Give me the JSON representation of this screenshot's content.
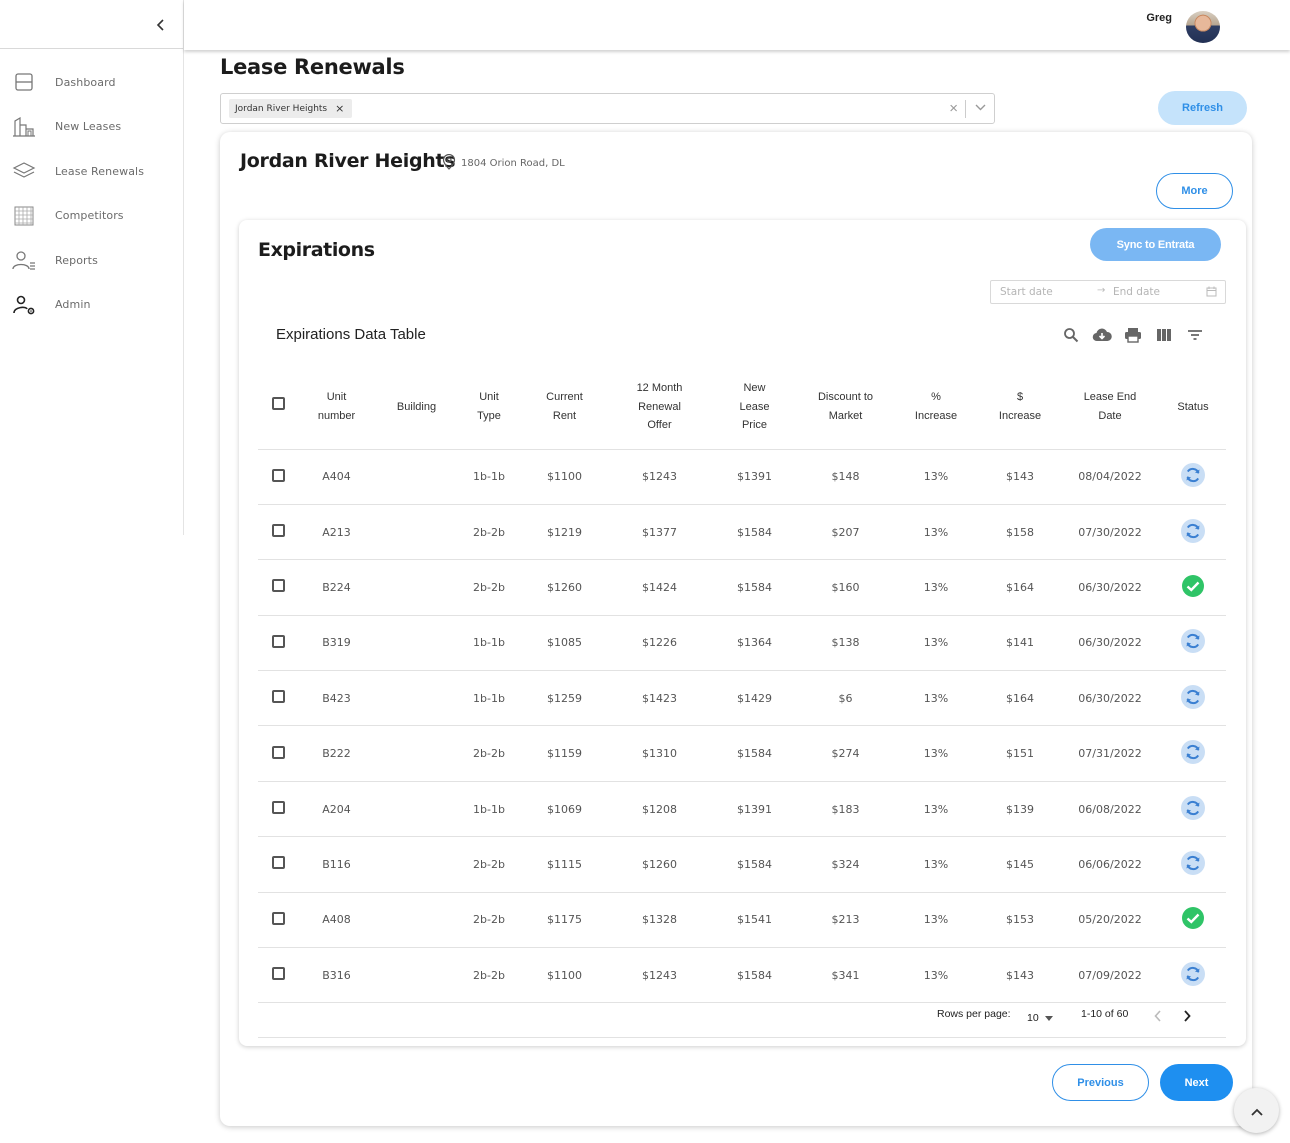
{
  "sidebar": {
    "collapse_icon": "chevron-left-icon",
    "items": [
      {
        "label": "Dashboard",
        "icon": "dashboard-icon"
      },
      {
        "label": "New Leases",
        "icon": "building-icon"
      },
      {
        "label": "Lease Renewals",
        "icon": "layers-icon"
      },
      {
        "label": "Competitors",
        "icon": "grid-icon"
      },
      {
        "label": "Reports",
        "icon": "user-list-icon"
      },
      {
        "label": "Admin",
        "icon": "user-gear-icon"
      }
    ]
  },
  "topbar": {
    "user_name": "Greg"
  },
  "page": {
    "title": "Lease Renewals"
  },
  "filter": {
    "chip_label": "Jordan River Heights",
    "chip_remove": "×",
    "clear": "×"
  },
  "refresh_label": "Refresh",
  "property": {
    "name": "Jordan River Heights",
    "address": "1804 Orion Road, DL",
    "more_label": "More"
  },
  "expirations": {
    "title": "Expirations",
    "sync_label": "Sync to Entrata",
    "date_range": {
      "start_placeholder": "Start date",
      "end_placeholder": "End date"
    },
    "table_title": "Expirations Data Table",
    "columns": [
      "Unit number",
      "Building",
      "Unit Type",
      "Current Rent",
      "12 Month Renewal Offer",
      "New Lease Price",
      "Discount to Market",
      "% Increase",
      "$ Increase",
      "Lease End Date",
      "Status"
    ],
    "rows": [
      {
        "unit": "A404",
        "building": "",
        "type": "1b-1b",
        "rent": "$1100",
        "offer": "$1243",
        "new_price": "$1391",
        "discount": "$148",
        "pct": "13%",
        "dollar": "$143",
        "end_date": "08/04/2022",
        "status": "pending"
      },
      {
        "unit": "A213",
        "building": "",
        "type": "2b-2b",
        "rent": "$1219",
        "offer": "$1377",
        "new_price": "$1584",
        "discount": "$207",
        "pct": "13%",
        "dollar": "$158",
        "end_date": "07/30/2022",
        "status": "pending"
      },
      {
        "unit": "B224",
        "building": "",
        "type": "2b-2b",
        "rent": "$1260",
        "offer": "$1424",
        "new_price": "$1584",
        "discount": "$160",
        "pct": "13%",
        "dollar": "$164",
        "end_date": "06/30/2022",
        "status": "done"
      },
      {
        "unit": "B319",
        "building": "",
        "type": "1b-1b",
        "rent": "$1085",
        "offer": "$1226",
        "new_price": "$1364",
        "discount": "$138",
        "pct": "13%",
        "dollar": "$141",
        "end_date": "06/30/2022",
        "status": "pending"
      },
      {
        "unit": "B423",
        "building": "",
        "type": "1b-1b",
        "rent": "$1259",
        "offer": "$1423",
        "new_price": "$1429",
        "discount": "$6",
        "pct": "13%",
        "dollar": "$164",
        "end_date": "06/30/2022",
        "status": "pending"
      },
      {
        "unit": "B222",
        "building": "",
        "type": "2b-2b",
        "rent": "$1159",
        "offer": "$1310",
        "new_price": "$1584",
        "discount": "$274",
        "pct": "13%",
        "dollar": "$151",
        "end_date": "07/31/2022",
        "status": "pending"
      },
      {
        "unit": "A204",
        "building": "",
        "type": "1b-1b",
        "rent": "$1069",
        "offer": "$1208",
        "new_price": "$1391",
        "discount": "$183",
        "pct": "13%",
        "dollar": "$139",
        "end_date": "06/08/2022",
        "status": "pending"
      },
      {
        "unit": "B116",
        "building": "",
        "type": "2b-2b",
        "rent": "$1115",
        "offer": "$1260",
        "new_price": "$1584",
        "discount": "$324",
        "pct": "13%",
        "dollar": "$145",
        "end_date": "06/06/2022",
        "status": "pending"
      },
      {
        "unit": "A408",
        "building": "",
        "type": "2b-2b",
        "rent": "$1175",
        "offer": "$1328",
        "new_price": "$1541",
        "discount": "$213",
        "pct": "13%",
        "dollar": "$153",
        "end_date": "05/20/2022",
        "status": "done"
      },
      {
        "unit": "B316",
        "building": "",
        "type": "2b-2b",
        "rent": "$1100",
        "offer": "$1243",
        "new_price": "$1584",
        "discount": "$341",
        "pct": "13%",
        "dollar": "$143",
        "end_date": "07/09/2022",
        "status": "pending"
      }
    ],
    "pagination": {
      "rows_per_page_label": "Rows per page:",
      "rows_per_page": "10",
      "range": "1-10 of 60"
    }
  },
  "nav_buttons": {
    "previous": "Previous",
    "next": "Next"
  },
  "colors": {
    "accent": "#1e8ff0",
    "refresh_bg": "#c5e3fb",
    "sync_bg": "#7ab7f3",
    "status_done": "#2ecc71",
    "status_pending": "#4a90d9"
  }
}
